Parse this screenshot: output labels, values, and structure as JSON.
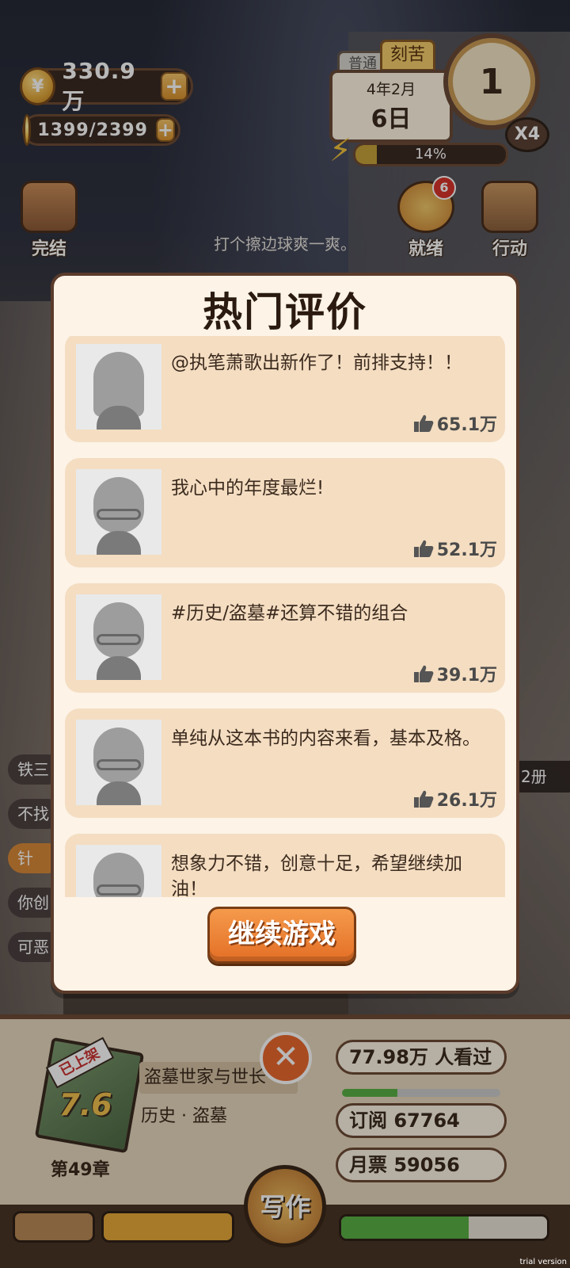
{
  "hud": {
    "coins": "330.9万",
    "ideas": "1399/2399",
    "plus": "+",
    "mode_normal": "普通",
    "mode_hard": "刻苦",
    "date_year_month": "4年2月",
    "date_day": "6日",
    "energy_percent": "14%",
    "energy_fraction": 0.14,
    "clock_value": "1",
    "speed": "X4"
  },
  "side_buttons": {
    "finish": "完结",
    "ready": "就绪",
    "ready_badge": "6",
    "action": "行动"
  },
  "hint": "打个擦边球爽一爽。",
  "left_chips": [
    "铁三",
    "不找",
    "针",
    "你创",
    "可恶"
  ],
  "right_chip": "2册",
  "modal": {
    "title": "热门评价",
    "reviews": [
      {
        "text": "@执笔萧歌出新作了！前排支持！！",
        "likes": "65.1万",
        "avatar": "long-hair"
      },
      {
        "text": "我心中的年度最烂!",
        "likes": "52.1万",
        "avatar": "glasses"
      },
      {
        "text": "#历史/盗墓#还算不错的组合",
        "likes": "39.1万",
        "avatar": "glasses"
      },
      {
        "text": "单纯从这本书的内容来看，基本及格。",
        "likes": "26.1万",
        "avatar": "glasses"
      },
      {
        "text": "想象力不错，创意十足，希望继续加油！",
        "likes": "",
        "avatar": "glasses"
      }
    ],
    "continue_label": "继续游戏"
  },
  "book": {
    "tag": "已上架",
    "score": "7.6",
    "chapter": "第49章",
    "title": "盗墓世家与世长",
    "genre": "历史 · 盗墓",
    "views": "77.98万 人看过",
    "views_progress": 0.35,
    "subscriptions": "订阅 67764",
    "monthly_tickets": "月票 59056"
  },
  "bottom": {
    "write_label": "写作",
    "progress": 0.62
  },
  "colors": {
    "accent": "#e36f26",
    "card": "#f4ddc1",
    "modal_bg": "#fdf3e7"
  },
  "watermark": "trial version"
}
